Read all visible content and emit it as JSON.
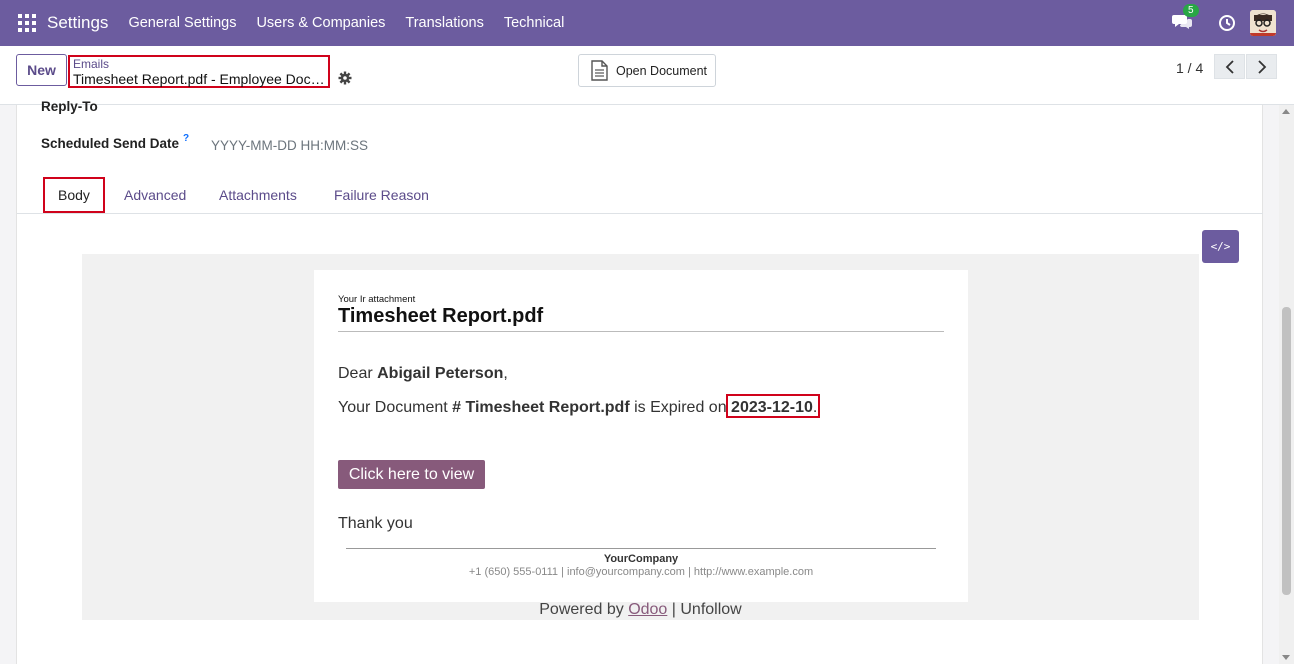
{
  "navbar": {
    "app_name": "Settings",
    "menus": [
      "General Settings",
      "Users & Companies",
      "Translations",
      "Technical"
    ],
    "chat_count": "5"
  },
  "control_panel": {
    "new_label": "New",
    "breadcrumb_parent": "Emails",
    "breadcrumb_current": "Timesheet Report.pdf - Employee Doc…",
    "open_document_label": "Open Document",
    "pager": "1 / 4"
  },
  "form": {
    "reply_to_label": "Reply-To",
    "scheduled_label": "Scheduled Send Date",
    "scheduled_help": "?",
    "scheduled_placeholder": "YYYY-MM-DD HH:MM:SS",
    "tabs": [
      "Body",
      "Advanced",
      "Attachments",
      "Failure Reason"
    ],
    "code_view_label": "</>"
  },
  "email": {
    "small_heading": "Your Ir attachment",
    "title": "Timesheet Report.pdf",
    "dear_prefix": "Dear ",
    "recipient": "Abigail Peterson",
    "dear_suffix": ",",
    "doc_prefix": "Your Document ",
    "doc_name": "# Timesheet Report.pdf",
    "doc_middle": " is Expired on ",
    "expiry_date": "2023-12-10",
    "doc_suffix": ".",
    "button_label": "Click here to view",
    "thanks": "Thank you",
    "company": "YourCompany",
    "contact": "+1 (650) 555-0111 | info@yourcompany.com | http://www.example.com",
    "powered_prefix": "Powered by ",
    "powered_link": "Odoo",
    "powered_suffix": " | Unfollow"
  },
  "colors": {
    "navbar": "#6c5c9f",
    "accent": "#5b4b8a",
    "email_button": "#875a7b",
    "highlight_box": "#d0021b"
  }
}
